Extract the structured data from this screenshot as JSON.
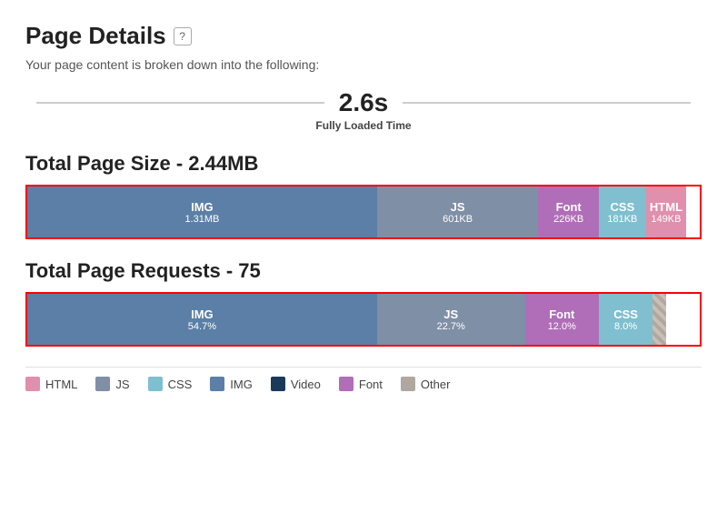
{
  "header": {
    "title": "Page Details",
    "help_label": "?",
    "subtitle": "Your page content is broken down into the following:"
  },
  "loaded_time": {
    "value": "2.6s",
    "label": "Fully Loaded Time"
  },
  "total_size": {
    "title": "Total Page Size - 2.44MB",
    "segments": [
      {
        "label": "IMG",
        "value": "1.31MB",
        "color": "img",
        "width": 52
      },
      {
        "label": "JS",
        "value": "601KB",
        "color": "js",
        "width": 24
      },
      {
        "label": "Font",
        "value": "226KB",
        "color": "font",
        "width": 9
      },
      {
        "label": "CSS",
        "value": "181KB",
        "color": "css",
        "width": 7
      },
      {
        "label": "HTML",
        "value": "149KB",
        "color": "html",
        "width": 6
      }
    ]
  },
  "total_requests": {
    "title": "Total Page Requests - 75",
    "segments": [
      {
        "label": "IMG",
        "value": "54.7%",
        "color": "img",
        "width": 52
      },
      {
        "label": "JS",
        "value": "22.7%",
        "color": "js",
        "width": 22
      },
      {
        "label": "Font",
        "value": "12.0%",
        "color": "font",
        "width": 11
      },
      {
        "label": "CSS",
        "value": "8.0%",
        "color": "css",
        "width": 8
      },
      {
        "label": "",
        "value": "",
        "color": "stripe",
        "width": 2
      }
    ]
  },
  "legend": [
    {
      "label": "HTML",
      "color": "html"
    },
    {
      "label": "JS",
      "color": "js"
    },
    {
      "label": "CSS",
      "color": "css"
    },
    {
      "label": "IMG",
      "color": "img"
    },
    {
      "label": "Video",
      "color": "video"
    },
    {
      "label": "Font",
      "color": "font"
    },
    {
      "label": "Other",
      "color": "other"
    }
  ]
}
